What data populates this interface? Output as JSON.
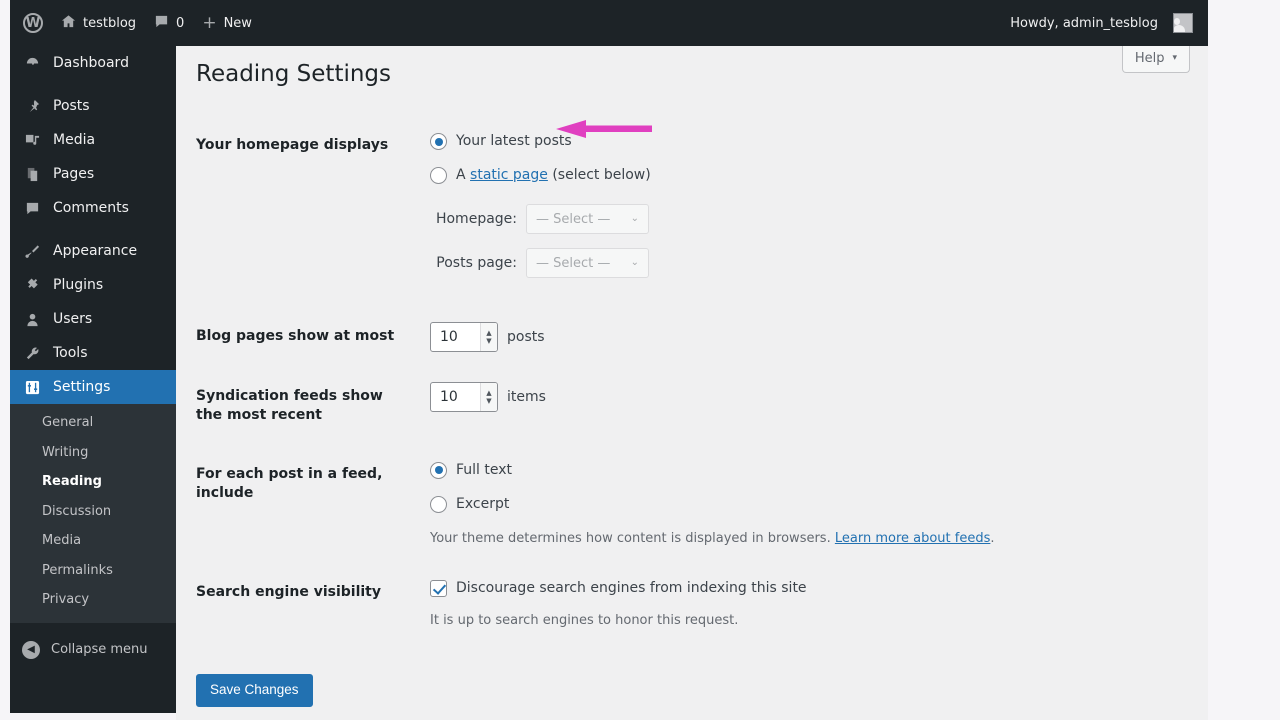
{
  "adminbar": {
    "wp_logo": "wordpress-logo-icon",
    "site_name": "testblog",
    "home_icon": "home-icon",
    "comments_icon": "comment-bubble-icon",
    "comments_count": "0",
    "new_plus": "+",
    "new_label": "New",
    "howdy": "Howdy, admin_tesblog",
    "avatar": "avatar-icon"
  },
  "sidebar": {
    "items": [
      {
        "label": "Dashboard",
        "icon": "dashboard-icon",
        "active": false
      },
      {
        "label": "Posts",
        "icon": "pin-icon",
        "active": false
      },
      {
        "label": "Media",
        "icon": "media-icon",
        "active": false
      },
      {
        "label": "Pages",
        "icon": "pages-icon",
        "active": false
      },
      {
        "label": "Comments",
        "icon": "comment-bubble-icon",
        "active": false
      },
      {
        "label": "Appearance",
        "icon": "paintbrush-icon",
        "active": false
      },
      {
        "label": "Plugins",
        "icon": "plug-icon",
        "active": false
      },
      {
        "label": "Users",
        "icon": "user-icon",
        "active": false
      },
      {
        "label": "Tools",
        "icon": "wrench-icon",
        "active": false
      },
      {
        "label": "Settings",
        "icon": "settings-sliders-icon",
        "active": true
      }
    ],
    "submenu": [
      {
        "label": "General",
        "current": false
      },
      {
        "label": "Writing",
        "current": false
      },
      {
        "label": "Reading",
        "current": true
      },
      {
        "label": "Discussion",
        "current": false
      },
      {
        "label": "Media",
        "current": false
      },
      {
        "label": "Permalinks",
        "current": false
      },
      {
        "label": "Privacy",
        "current": false
      }
    ],
    "collapse": {
      "label": "Collapse menu",
      "icon": "chevron-left-circle-icon"
    }
  },
  "content": {
    "help_button": {
      "label": "Help",
      "caret": "▾"
    },
    "page_title": "Reading Settings",
    "homepage_displays": {
      "label": "Your homepage displays",
      "option_latest": "Your latest posts",
      "option_static_prefix": "A ",
      "option_static_link": "static page",
      "option_static_suffix": " (select below)",
      "selected": "latest",
      "homepage_label": "Homepage:",
      "homepage_value": "— Select —",
      "postspage_label": "Posts page:",
      "postspage_value": "— Select —",
      "select_caret": "⌄"
    },
    "blog_pages": {
      "label": "Blog pages show at most",
      "value": "10",
      "unit": "posts"
    },
    "syndication": {
      "label": "Syndication feeds show the most recent",
      "value": "10",
      "unit": "items"
    },
    "feed_include": {
      "label": "For each post in a feed, include",
      "option_full": "Full text",
      "option_excerpt": "Excerpt",
      "selected": "full",
      "desc_prefix": "Your theme determines how content is displayed in browsers. ",
      "desc_link": "Learn more about feeds",
      "desc_suffix": "."
    },
    "search_visibility": {
      "label": "Search engine visibility",
      "checkbox_label": "Discourage search engines from indexing this site",
      "checked": true,
      "desc": "It is up to search engines to honor this request."
    },
    "save_button": "Save Changes"
  },
  "annotation": {
    "arrow": "left-pointing-arrow-annotation",
    "color": "#e040c0",
    "points_at": "Your latest posts"
  },
  "colors": {
    "accent": "#2271b1",
    "admin_dark": "#1d2327",
    "submenu_dark": "#2c3338",
    "content_bg": "#f0f0f1",
    "annotation_pink": "#e040c0"
  }
}
